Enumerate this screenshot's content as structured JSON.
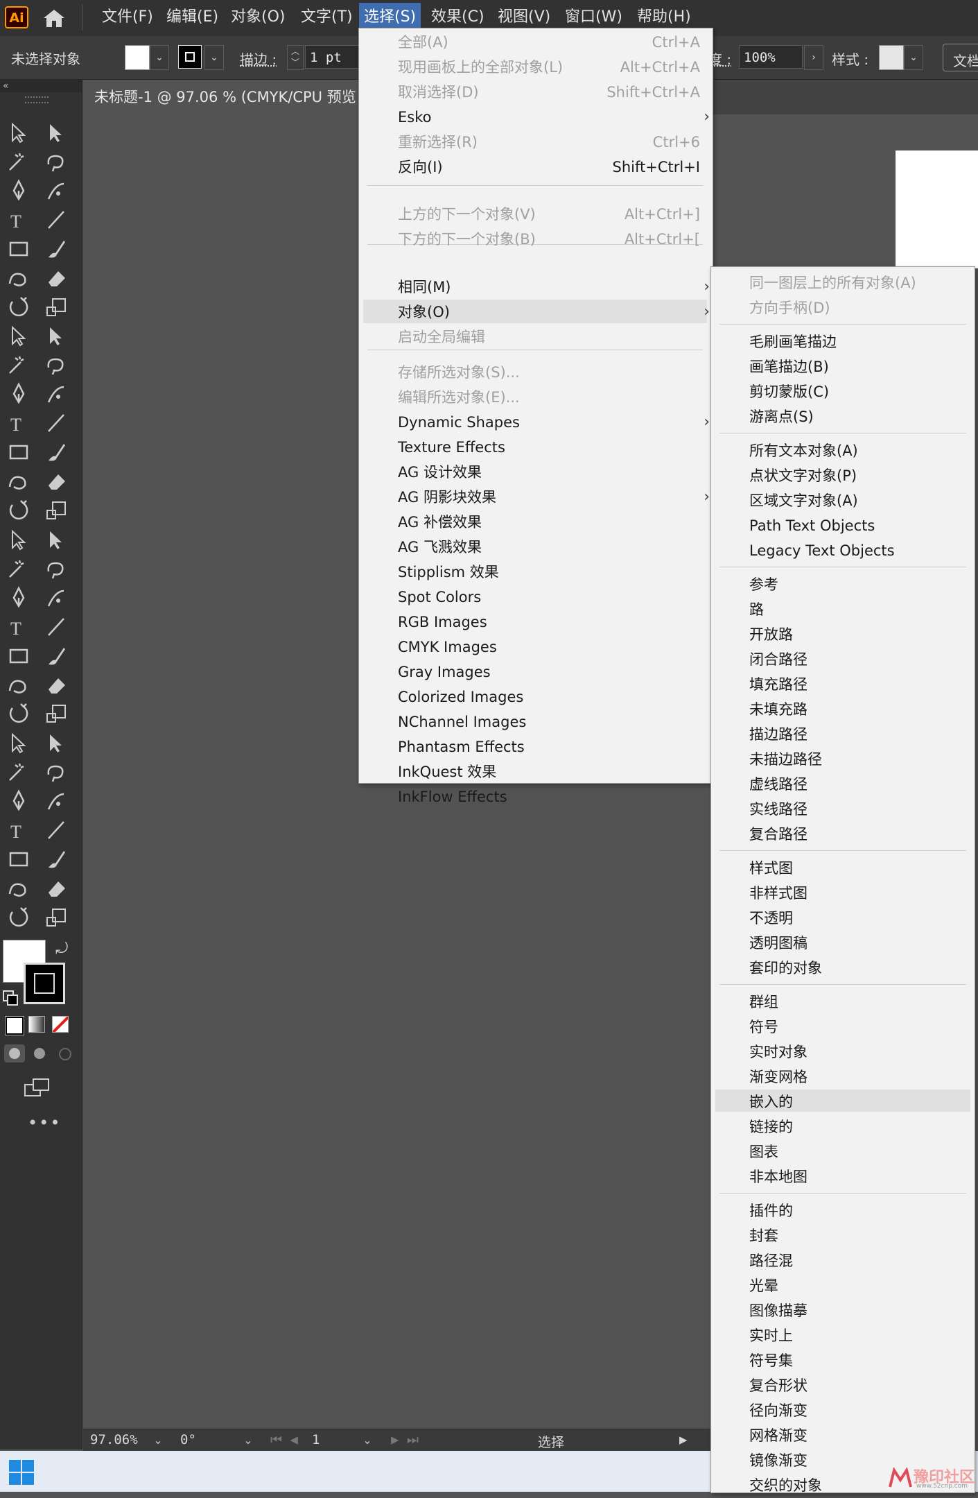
{
  "app": {
    "logo": "Ai"
  },
  "menubar": {
    "items": [
      "文件(F)",
      "编辑(E)",
      "对象(O)",
      "文字(T)",
      "选择(S)",
      "效果(C)",
      "视图(V)",
      "窗口(W)",
      "帮助(H)"
    ]
  },
  "controlbar": {
    "selection_status": "未选择对象",
    "stroke_label": "描边 :",
    "stroke_value": "1 pt",
    "opacity_label_partial": "度 :",
    "opacity_value": "100%",
    "style_label": "样式 :",
    "doc_setup_partial": "文档"
  },
  "document": {
    "tab_title": "未标题-1 @ 97.06 % (CMYK/CPU 预览"
  },
  "statusbar": {
    "zoom": "97.06%",
    "rotation": "0°",
    "artboard": "1",
    "tool_status": "选择"
  },
  "select_menu": {
    "items": [
      {
        "label": "全部(A)",
        "shortcut": "Ctrl+A",
        "disabled": true
      },
      {
        "label": "现用画板上的全部对象(L)",
        "shortcut": "Alt+Ctrl+A",
        "disabled": true
      },
      {
        "label": "取消选择(D)",
        "shortcut": "Shift+Ctrl+A",
        "disabled": true
      },
      {
        "label": "Esko",
        "submenu": true
      },
      {
        "label": "重新选择(R)",
        "shortcut": "Ctrl+6",
        "disabled": true
      },
      {
        "label": "反向(I)",
        "shortcut": "Shift+Ctrl+I"
      },
      {
        "label": "上方的下一个对象(V)",
        "shortcut": "Alt+Ctrl+]",
        "disabled": true
      },
      {
        "label": "下方的下一个对象(B)",
        "shortcut": "Alt+Ctrl+[",
        "disabled": true
      },
      {
        "label": "相同(M)",
        "submenu": true
      },
      {
        "label": "对象(O)",
        "submenu": true,
        "highlighted": true
      },
      {
        "label": "启动全局编辑",
        "disabled": true
      },
      {
        "label": "存储所选对象(S)...",
        "disabled": true
      },
      {
        "label": "编辑所选对象(E)...",
        "disabled": true
      },
      {
        "label": "Dynamic Shapes",
        "submenu": true
      },
      {
        "label": "Texture Effects"
      },
      {
        "label": "AG 设计效果"
      },
      {
        "label": "AG 阴影块效果",
        "submenu": true
      },
      {
        "label": "AG 补偿效果"
      },
      {
        "label": "AG 飞溅效果"
      },
      {
        "label": "Stipplism 效果"
      },
      {
        "label": "Spot Colors"
      },
      {
        "label": "RGB Images"
      },
      {
        "label": "CMYK Images"
      },
      {
        "label": "Gray Images"
      },
      {
        "label": "Colorized Images"
      },
      {
        "label": "NChannel Images"
      },
      {
        "label": "Phantasm Effects"
      },
      {
        "label": "InkQuest 效果"
      },
      {
        "label": "InkFlow Effects"
      }
    ]
  },
  "object_submenu": {
    "items": [
      {
        "label": "同一图层上的所有对象(A)",
        "disabled": true
      },
      {
        "label": "方向手柄(D)",
        "disabled": true
      },
      {
        "label": "毛刷画笔描边"
      },
      {
        "label": "画笔描边(B)"
      },
      {
        "label": "剪切蒙版(C)"
      },
      {
        "label": "游离点(S)"
      },
      {
        "label": "所有文本对象(A)"
      },
      {
        "label": "点状文字对象(P)"
      },
      {
        "label": "区域文字对象(A)"
      },
      {
        "label": "Path Text Objects"
      },
      {
        "label": "Legacy Text Objects"
      },
      {
        "label": "参考"
      },
      {
        "label": "路"
      },
      {
        "label": "开放路"
      },
      {
        "label": "闭合路径"
      },
      {
        "label": "填充路径"
      },
      {
        "label": "未填充路"
      },
      {
        "label": "描边路径"
      },
      {
        "label": "未描边路径"
      },
      {
        "label": "虚线路径"
      },
      {
        "label": "实线路径"
      },
      {
        "label": "复合路径"
      },
      {
        "label": "样式图"
      },
      {
        "label": "非样式图"
      },
      {
        "label": "不透明"
      },
      {
        "label": "透明图稿"
      },
      {
        "label": "套印的对象"
      },
      {
        "label": "群组"
      },
      {
        "label": "符号"
      },
      {
        "label": "实时对象"
      },
      {
        "label": "渐变网格"
      },
      {
        "label": "嵌入的",
        "highlighted": true
      },
      {
        "label": "链接的"
      },
      {
        "label": "图表"
      },
      {
        "label": "非本地图"
      },
      {
        "label": "插件的"
      },
      {
        "label": "封套"
      },
      {
        "label": "路径混"
      },
      {
        "label": "光晕"
      },
      {
        "label": "图像描摹"
      },
      {
        "label": "实时上"
      },
      {
        "label": "符号集"
      },
      {
        "label": "复合形状"
      },
      {
        "label": "径向渐变"
      },
      {
        "label": "网格渐变"
      },
      {
        "label": "镜像渐变"
      },
      {
        "label": "交织的对象"
      }
    ]
  },
  "watermark": {
    "text": "豫印社区",
    "url": "www.52cnp.com"
  },
  "colors": {
    "accent": "#3f6db0",
    "ai_logo_orange": "#ff9a00",
    "menu_bg": "#f2f2f2",
    "ui_dark": "#323232",
    "canvas": "#535353"
  }
}
